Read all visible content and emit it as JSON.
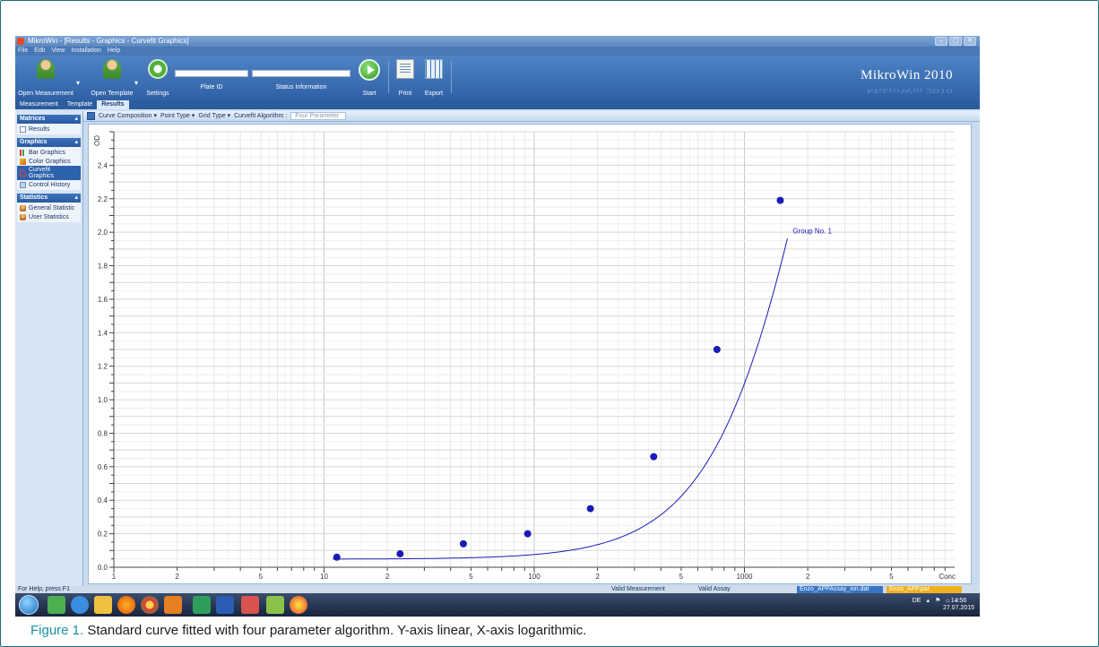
{
  "window": {
    "title": "MikroWin - [Results - Graphics - Curvefit Graphics]",
    "controls": [
      "–",
      "▢",
      "✕"
    ]
  },
  "menu": [
    "File",
    "Edit",
    "View",
    "Installation",
    "Help"
  ],
  "toolbar": {
    "open_measurement": "Open Measurement",
    "open_template": "Open Template",
    "settings": "Settings",
    "plate_id_label": "Plate ID",
    "status_label": "Status Information",
    "start": "Start",
    "print": "Print",
    "export": "Export",
    "brand": "MikroWin 2010"
  },
  "tabs": [
    {
      "label": "Measurement",
      "active": false
    },
    {
      "label": "Template",
      "active": false
    },
    {
      "label": "Results",
      "active": true
    }
  ],
  "nav": {
    "matrices": {
      "title": "Matrices",
      "items": [
        "Results"
      ]
    },
    "graphics": {
      "title": "Graphics",
      "items": [
        "Bar Graphics",
        "Color Graphics",
        "Curvefit Graphics",
        "Control History"
      ]
    },
    "statistics": {
      "title": "Statistics",
      "items": [
        "General Statistic",
        "User Statistics"
      ]
    }
  },
  "subtoolbar": {
    "curve_composition": "Curve Composition ▾",
    "point_type": "Point Type ▾",
    "grid_type": "Grid Type ▾",
    "curvefit_label": "Curvefit Algorithm :",
    "curvefit_value": "Four Parameter"
  },
  "chart_data": {
    "type": "scatter",
    "fit": "four parameter logistic",
    "x_scale": "log",
    "y_scale": "linear",
    "xlim": [
      1,
      10000
    ],
    "ylim": [
      0,
      2.6
    ],
    "ylabel": "OD",
    "xlabel": "Conc",
    "y_ticks": [
      "0.0",
      "0.2",
      "0.4",
      "0.6",
      "0.8",
      "1.0",
      "1.2",
      "1.4",
      "1.6",
      "1.8",
      "2.0",
      "2.2",
      "2.4"
    ],
    "x_tick_labels": [
      {
        "v": 1,
        "t": "1"
      },
      {
        "v": 2,
        "t": "2"
      },
      {
        "v": 5,
        "t": "5"
      },
      {
        "v": 10,
        "t": "10"
      },
      {
        "v": 20,
        "t": "2"
      },
      {
        "v": 50,
        "t": "5"
      },
      {
        "v": 100,
        "t": "100"
      },
      {
        "v": 200,
        "t": "2"
      },
      {
        "v": 500,
        "t": "5"
      },
      {
        "v": 1000,
        "t": "1000"
      },
      {
        "v": 2000,
        "t": "2"
      },
      {
        "v": 5000,
        "t": "5"
      }
    ],
    "grid": true,
    "series": [
      {
        "name": "Group No. 1",
        "color": "#1a1ab8",
        "x": [
          11.5,
          23,
          46,
          93,
          185,
          370,
          740,
          1480
        ],
        "y": [
          0.06,
          0.08,
          0.14,
          0.2,
          0.35,
          0.66,
          1.3,
          2.19
        ]
      }
    ],
    "curve_range": [
      11,
      1600
    ],
    "curve_params": {
      "a": 0.048,
      "b": 1.65,
      "c": 2700,
      "d": 6.5
    }
  },
  "status": {
    "help": "For Help, press F1",
    "valid_measurement": "Valid Measurement",
    "valid_assay": "Valid Assay",
    "file1": "Enzo_APPAssay_ion.dat",
    "file2": "Enzo_APP.par"
  },
  "taskbar": {
    "lang": "DE",
    "time": "14:56",
    "date": "27.07.2015"
  },
  "caption": {
    "figure": "Figure 1.",
    "text": "Standard curve fitted with four parameter algorithm. Y-axis linear, X-axis logarithmic."
  },
  "colors": {
    "ribbon": "#3a6db2",
    "data": "#1a1ab8",
    "file1": "#3a74c4",
    "file2": "#f2b01e"
  }
}
